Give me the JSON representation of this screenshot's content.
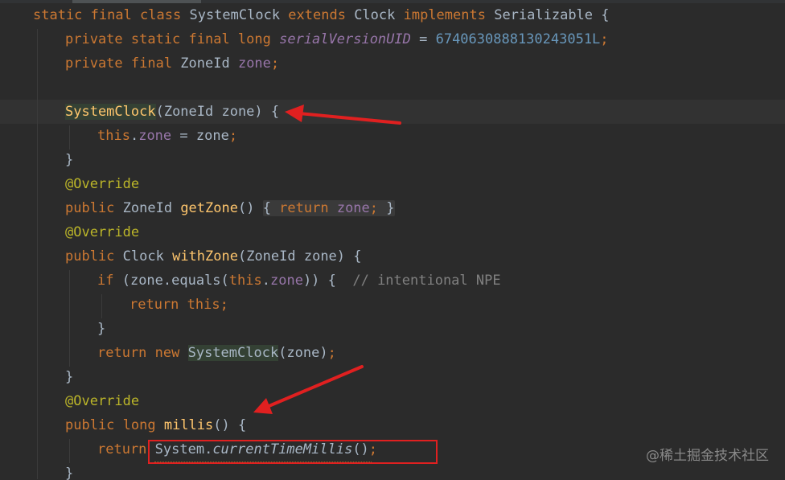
{
  "code": {
    "l1": {
      "kw1": "static final class ",
      "name": "SystemClock ",
      "kw2": "extends ",
      "parent": "Clock ",
      "kw3": "implements ",
      "iface": "Serializable {"
    },
    "l2": {
      "kw": "private static final long ",
      "field": "serialVersionUID",
      "eq": " = ",
      "num": "6740630888130243051L",
      "semi": ";"
    },
    "l3": {
      "kw": "private final ",
      "type": "ZoneId ",
      "field": "zone",
      "semi": ";"
    },
    "l5": {
      "ctor": "SystemClock",
      "params": "(ZoneId zone) {"
    },
    "l6": {
      "kw": "this",
      "dot": ".",
      "field": "zone",
      "rest": " = zone",
      "semi": ";"
    },
    "l7": {
      "text": "}"
    },
    "l8": {
      "ann": "@Override"
    },
    "l9": {
      "kw": "public ",
      "type": "ZoneId ",
      "fn": "getZone",
      "parens": "() ",
      "ob": "{ ",
      "kw2": "return ",
      "field": "zone",
      "semi": "; ",
      "cb": "}"
    },
    "l10": {
      "ann": "@Override"
    },
    "l11": {
      "kw": "public ",
      "type": "Clock ",
      "fn": "withZone",
      "params": "(ZoneId zone) {"
    },
    "l12": {
      "kw": "if ",
      "p1": "(zone.equals(",
      "kw2": "this",
      "dot": ".",
      "field": "zone",
      "p2": ")) {  ",
      "cmt": "// intentional NPE"
    },
    "l13": {
      "kw": "return this",
      "semi": ";"
    },
    "l14": {
      "text": "}"
    },
    "l15": {
      "kw": "return new ",
      "ctor": "SystemClock",
      "args": "(zone)",
      "semi": ";"
    },
    "l16": {
      "text": "}"
    },
    "l17": {
      "ann": "@Override"
    },
    "l18": {
      "kw": "public long ",
      "fn": "millis",
      "params": "() {"
    },
    "l19": {
      "kw": "return ",
      "cls": "System.",
      "method": "currentTimeMillis",
      "args": "()",
      "semi": ";"
    },
    "l20": {
      "text": "}"
    }
  },
  "watermark": "@稀土掘金技术社区",
  "colors": {
    "background": "#2b2b2b",
    "keyword": "#cc7832",
    "number": "#6897bb",
    "field": "#9876aa",
    "annotation": "#bbb529",
    "function": "#ffc66d",
    "comment": "#808080",
    "default": "#a9b7c6",
    "arrow": "#e02020"
  }
}
